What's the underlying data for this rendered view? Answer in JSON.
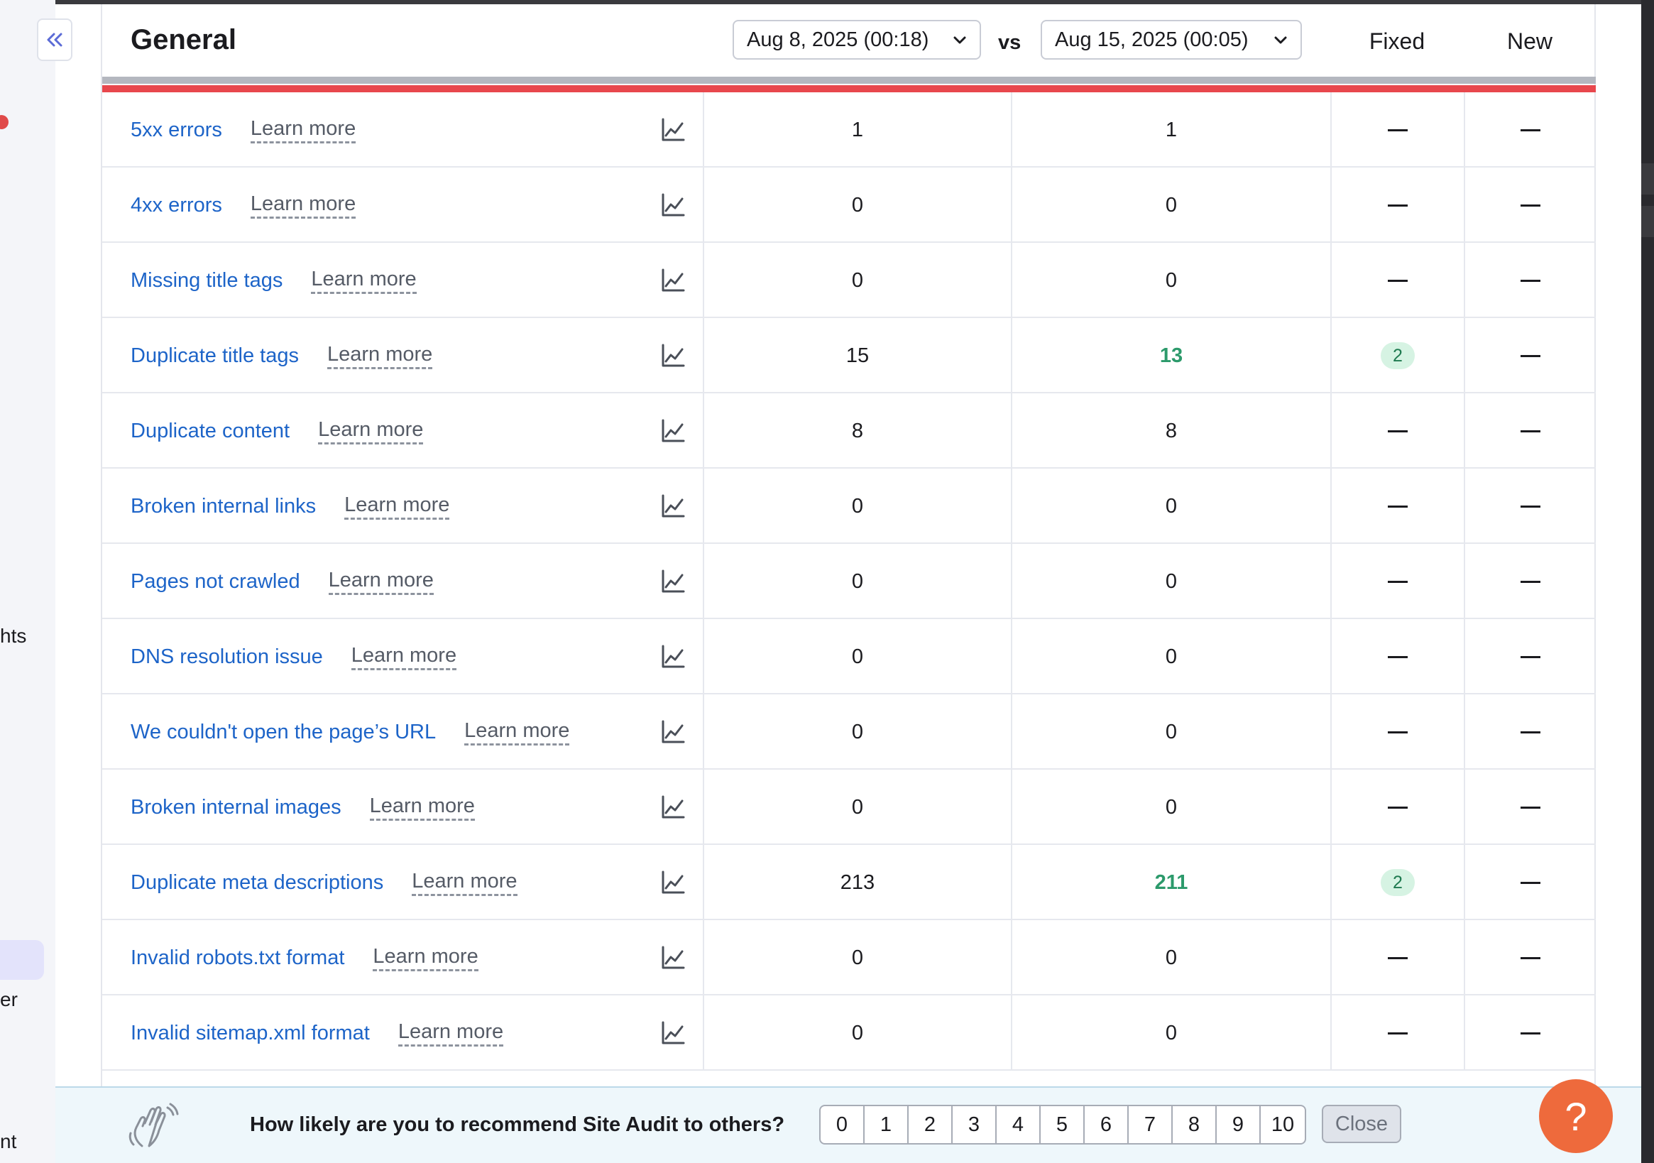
{
  "sidebar": {
    "fragments": [
      "hts",
      "er",
      "nt"
    ]
  },
  "header": {
    "title": "General",
    "date_from": "Aug 8, 2025 (00:18)",
    "vs": "vs",
    "date_to": "Aug 15, 2025 (00:05)",
    "fixed_label": "Fixed",
    "new_label": "New"
  },
  "rows": [
    {
      "issue": "5xx errors",
      "learn": "Learn more",
      "prev": "1",
      "curr": "1",
      "fixed": "—",
      "new": "—"
    },
    {
      "issue": "4xx errors",
      "learn": "Learn more",
      "prev": "0",
      "curr": "0",
      "fixed": "—",
      "new": "—"
    },
    {
      "issue": "Missing title tags",
      "learn": "Learn more",
      "prev": "0",
      "curr": "0",
      "fixed": "—",
      "new": "—"
    },
    {
      "issue": "Duplicate title tags",
      "learn": "Learn more",
      "prev": "15",
      "curr": "13",
      "fixed": "2",
      "new": "—"
    },
    {
      "issue": "Duplicate content",
      "learn": "Learn more",
      "prev": "8",
      "curr": "8",
      "fixed": "—",
      "new": "—"
    },
    {
      "issue": "Broken internal links",
      "learn": "Learn more",
      "prev": "0",
      "curr": "0",
      "fixed": "—",
      "new": "—"
    },
    {
      "issue": "Pages not crawled",
      "learn": "Learn more",
      "prev": "0",
      "curr": "0",
      "fixed": "—",
      "new": "—"
    },
    {
      "issue": "DNS resolution issue",
      "learn": "Learn more",
      "prev": "0",
      "curr": "0",
      "fixed": "—",
      "new": "—"
    },
    {
      "issue": "We couldn't open the page’s URL",
      "learn": "Learn more",
      "prev": "0",
      "curr": "0",
      "fixed": "—",
      "new": "—"
    },
    {
      "issue": "Broken internal images",
      "learn": "Learn more",
      "prev": "0",
      "curr": "0",
      "fixed": "—",
      "new": "—"
    },
    {
      "issue": "Duplicate meta descriptions",
      "learn": "Learn more",
      "prev": "213",
      "curr": "211",
      "fixed": "2",
      "new": "—"
    },
    {
      "issue": "Invalid robots.txt format",
      "learn": "Learn more",
      "prev": "0",
      "curr": "0",
      "fixed": "—",
      "new": "—"
    },
    {
      "issue": "Invalid sitemap.xml format",
      "learn": "Learn more",
      "prev": "0",
      "curr": "0",
      "fixed": "—",
      "new": "—"
    }
  ],
  "survey": {
    "question": "How likely are you to recommend Site Audit to others?",
    "scale": [
      "0",
      "1",
      "2",
      "3",
      "4",
      "5",
      "6",
      "7",
      "8",
      "9",
      "10"
    ],
    "close_label": "Close"
  },
  "help": {
    "label": "?"
  },
  "colors": {
    "link": "#1d64c8",
    "improved": "#2c9a6b",
    "error_bar": "#e8474d",
    "help_button": "#ee6a3c"
  },
  "icons": [
    "collapse-icon",
    "chevron-down-icon",
    "trend-chart-icon",
    "waving-hand-icon"
  ]
}
